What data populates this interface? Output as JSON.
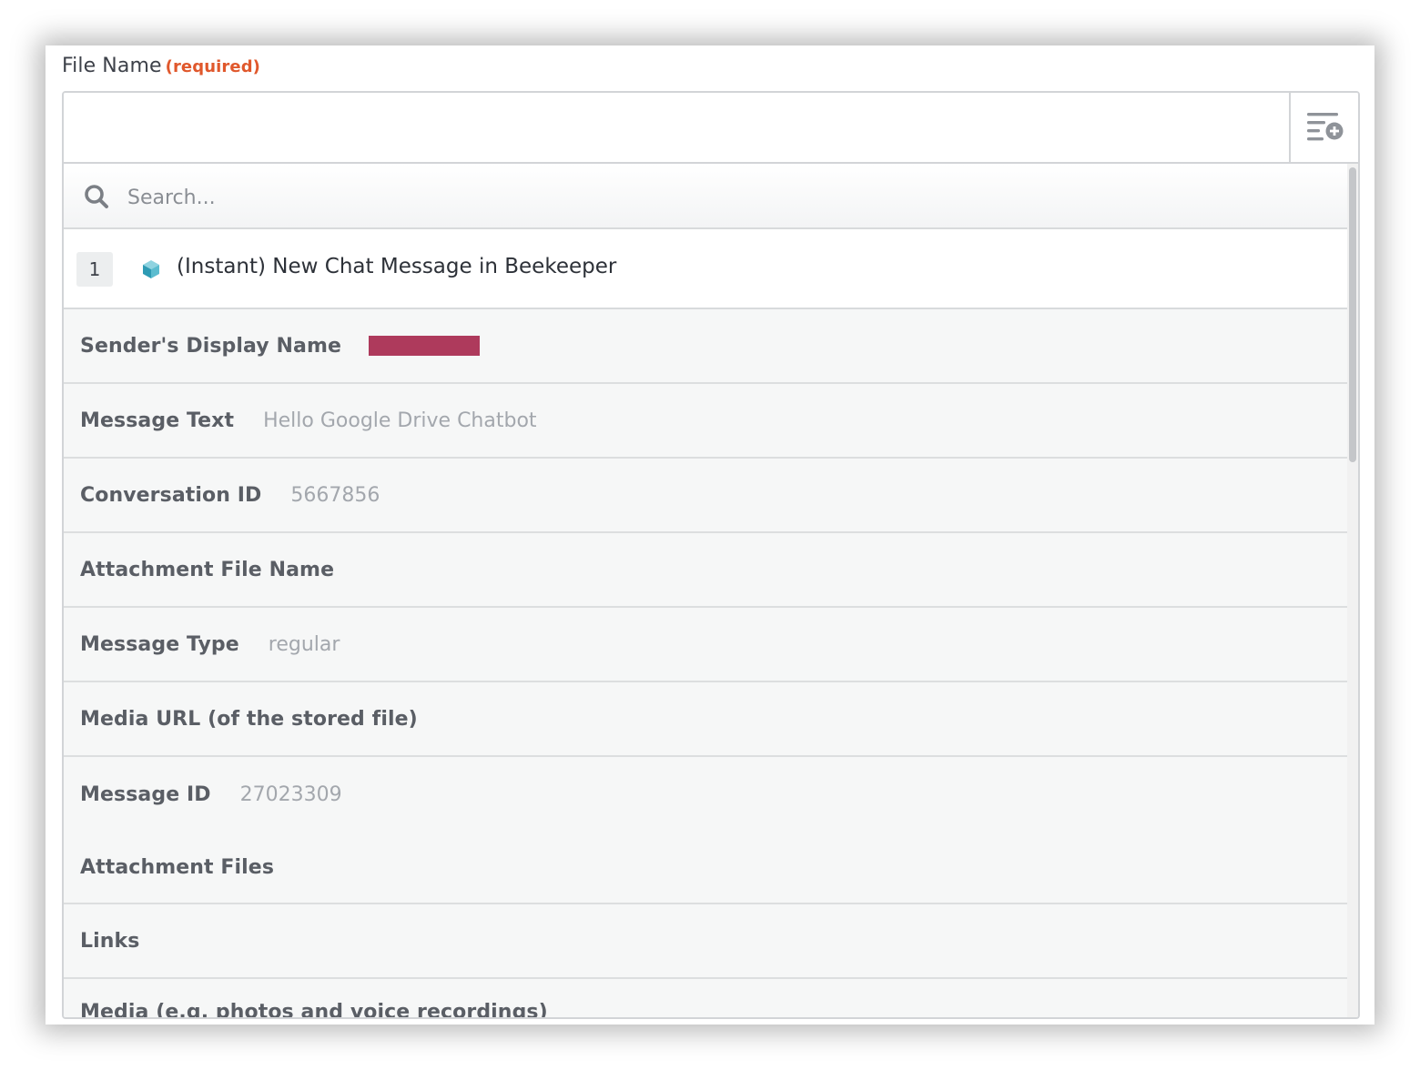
{
  "field": {
    "label": "File Name",
    "required_label": "(required)",
    "value": "",
    "insert_icon": "insert-field-icon"
  },
  "search": {
    "placeholder": "Search...",
    "icon": "search-icon"
  },
  "step": {
    "number": "1",
    "title": "(Instant) New Chat Message in Beekeeper",
    "app_icon": "beekeeper-app-icon"
  },
  "fields": [
    {
      "label": "Sender's Display Name",
      "value": "",
      "redacted": true
    },
    {
      "label": "Message Text",
      "value": "Hello Google Drive Chatbot"
    },
    {
      "label": "Conversation ID",
      "value": "5667856"
    },
    {
      "label": "Attachment File Name",
      "value": ""
    },
    {
      "label": "Message Type",
      "value": "regular"
    },
    {
      "label": "Media URL (of the stored file)",
      "value": ""
    },
    {
      "label": "Message ID",
      "value": "27023309"
    },
    {
      "label": "Attachment Files",
      "value": ""
    },
    {
      "label": "Links",
      "value": ""
    },
    {
      "label": "Media (e.g. photos and voice recordings)",
      "value": ""
    }
  ],
  "colors": {
    "required": "#e0582c",
    "redaction": "#ae3a5c",
    "border": "#d2d4d7"
  }
}
